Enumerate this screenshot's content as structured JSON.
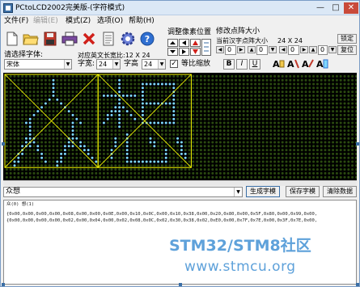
{
  "window": {
    "title": "PCtoLCD2002完美版-(字符模式)",
    "controls": {
      "minimize": "—",
      "maximize": "□",
      "close": "✕"
    }
  },
  "menu": [
    {
      "label": "文件(F)",
      "enabled": true
    },
    {
      "label": "编辑(E)",
      "enabled": false
    },
    {
      "label": "模式(Z)",
      "enabled": true
    },
    {
      "label": "选项(O)",
      "enabled": true
    },
    {
      "label": "帮助(H)",
      "enabled": true
    }
  ],
  "panel": {
    "adjust_pixel_label": "调整像素位置",
    "modify_dot_label": "修改点阵大小",
    "current_dot_label": "当前汉字点阵大小",
    "current_dot_value": "24 X 24",
    "lock_button": "锁定",
    "reset_button": "复位",
    "stepper1_value": "0",
    "stepper2_value": "0",
    "stepper3_value": "0",
    "stepper4_value": "0"
  },
  "font": {
    "select_label": "请选择字体:",
    "font_value": "宋体",
    "align_label": "对应英文长宽比:12 X 24",
    "width_label": "字宽:",
    "width_value": "24",
    "height_label": "字高",
    "height_value": "24",
    "scale_label": "等比缩放",
    "scale_checked": true,
    "bold": "B",
    "italic": "I",
    "underline": "U"
  },
  "input": {
    "text": "众想",
    "generate_button": "生成字模",
    "save_button": "保存字模",
    "clear_button": "清除数据"
  },
  "output": {
    "header": "众(0) 想(1)",
    "line1": "{0x00,0x00,0x00,0x00,0x08,0x00,0x00,0x0E,0x00,0x10,0x0C,0x00,0x10,0x38,0x00,0x20,0x80,0x00,0x5F,0x80,0x00,0x99,0x00,",
    "line2": "{0x00,0x00,0x00,0x00,0x02,0x00,0x04,0x00,0x02,0x08,0x0C,0x02,0x30,0x38,0x02,0xE0,0x00,0x7F,0x7E,0x00,0x3F,0x7E,0x00,"
  },
  "watermark": {
    "brand_a": "STM32",
    "brand_sep": "/",
    "brand_b": "STM8社区",
    "url": "www.stmcu.org"
  },
  "colors": {
    "dot_off": "#2b4a10",
    "dot_on": "#7fd8ff",
    "grid_bg": "#000000",
    "box_line": "#ffff00",
    "watermark": "#5ea1da"
  }
}
